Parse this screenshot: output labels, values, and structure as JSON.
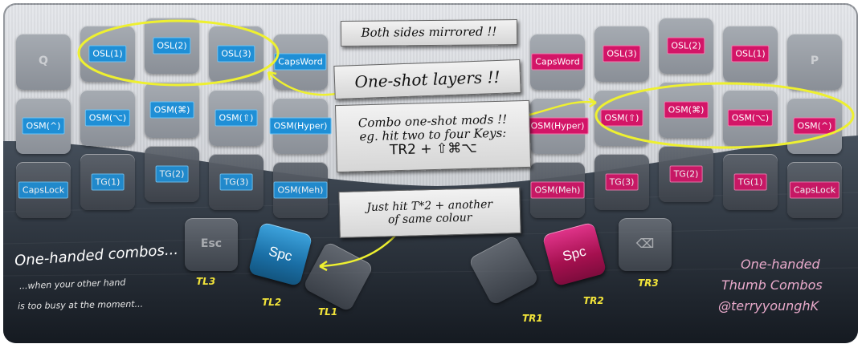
{
  "colors": {
    "left_accent": "#1f8fd6",
    "right_accent": "#d31567",
    "annotation": "#eef030"
  },
  "left": {
    "row1": [
      "Q",
      "OSL(1)",
      "OSL(2)",
      "OSL(3)",
      "CapsWord"
    ],
    "row2": [
      "OSM(^)",
      "OSM(⌥)",
      "OSM(⌘)",
      "OSM(⇧)",
      "OSM(Hyper)"
    ],
    "row3": [
      "CapsLock",
      "TG(1)",
      "TG(2)",
      "TG(3)",
      "OSM(Meh)"
    ],
    "thumbs": [
      "Esc",
      "Spc",
      ""
    ],
    "thumb_tags": [
      "TL3",
      "TL2",
      "TL1"
    ]
  },
  "right": {
    "row1": [
      "CapsWord",
      "OSL(3)",
      "OSL(2)",
      "OSL(1)",
      "P"
    ],
    "row2": [
      "OSM(Hyper)",
      "OSM(⇧)",
      "OSM(⌘)",
      "OSM(⌥)",
      "OSM(^)"
    ],
    "row3": [
      "OSM(Meh)",
      "TG(3)",
      "TG(2)",
      "TG(1)",
      "CapsLock"
    ],
    "thumbs": [
      "",
      "Spc",
      "⌫"
    ],
    "thumb_tags": [
      "TR1",
      "TR2",
      "TR3"
    ]
  },
  "notes": {
    "mirrored": "Both sides mirrored !!",
    "oneshot_layers": "One-shot layers !!",
    "combo_line1": "Combo one-shot mods !!",
    "combo_line2": "eg. hit two to four Keys:",
    "combo_line3": "TR2 + ⇧⌘⌥",
    "justhit_line1": "Just hit T*2 + another",
    "justhit_line2": "of same colour"
  },
  "left_caption": {
    "title": "One-handed combos...",
    "line1": "...when your other hand",
    "line2": "is too busy at the moment..."
  },
  "right_caption": {
    "line1": "One-handed",
    "line2": "Thumb Combos",
    "line3": "@terryyounghK"
  }
}
